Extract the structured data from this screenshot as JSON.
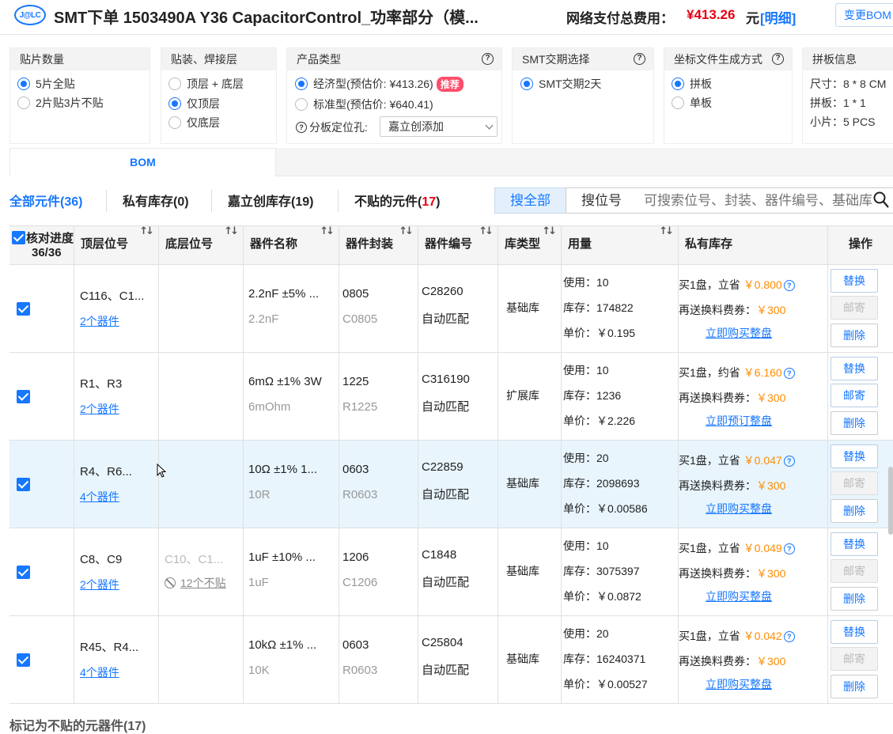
{
  "header": {
    "logo_text": "J@LC",
    "title": "SMT下单  1503490A  Y36  CapacitorControl_功率部分（模...",
    "fee_label": "网络支付总费用：",
    "fee_value": "¥413.26",
    "fee_unit": "元",
    "fee_detail": "[明细]",
    "change_bom": "变更BOM"
  },
  "options": {
    "qty": {
      "title": "贴片数量",
      "items": [
        "5片全贴",
        "2片贴3片不贴"
      ],
      "selected": 0
    },
    "layer": {
      "title": "贴装、焊接层",
      "items": [
        "顶层 + 底层",
        "仅顶层",
        "仅底层"
      ],
      "selected": 1
    },
    "product": {
      "title": "产品类型",
      "items": [
        "经济型(预估价: ¥413.26)",
        "标准型(预估价: ¥640.41)"
      ],
      "selected": 0,
      "badge": "推荐",
      "hole_label": "分板定位孔:",
      "hole_value": "嘉立创添加"
    },
    "delivery": {
      "title": "SMT交期选择",
      "items": [
        "SMT交期2天"
      ],
      "selected": 0
    },
    "coord": {
      "title": "坐标文件生成方式",
      "items": [
        "拼板",
        "单板"
      ],
      "selected": 0
    },
    "panel": {
      "title": "拼板信息",
      "size": "尺寸：8 * 8 CM",
      "panelize": "拼板：1 * 1",
      "pieces": "小片：5 PCS"
    }
  },
  "tabs": {
    "bom": "BOM"
  },
  "filters": [
    {
      "label": "全部元件(",
      "count": "36",
      "end": ")"
    },
    {
      "label": "私有库存(",
      "count": "0",
      "end": ")"
    },
    {
      "label": "嘉立创库存(",
      "count": "19",
      "end": ")"
    },
    {
      "label": "不贴的元件(",
      "count": "17",
      "end": ")"
    }
  ],
  "search": {
    "all": "搜全部",
    "pos": "搜位号",
    "placeholder": "可搜索位号、封装、器件编号、基础库"
  },
  "table": {
    "headers": [
      "核对进度",
      "36/36",
      "顶层位号",
      "底层位号",
      "器件名称",
      "器件封装",
      "器件编号",
      "库类型",
      "用量",
      "私有库存",
      "操作"
    ],
    "rows": [
      {
        "top": "C116、C1...",
        "top_count": "2个器件",
        "bottom": "",
        "bottom_note": "",
        "name": "2.2nF ±5% ...",
        "name_sub": "2.2nF",
        "pkg": "0805",
        "pkg_sub": "C0805",
        "code": "C28260",
        "match": "自动匹配",
        "lib": "基础库",
        "use": "使用：10",
        "stock": "库存：174822",
        "price": "单价：￥0.195",
        "buy": "买1盘，立省",
        "save": "￥0.800",
        "coupon": "再送换料费券：",
        "coupon_val": "￥300",
        "action_link": "立即购买整盘",
        "btn1": "替换",
        "btn2": "邮寄",
        "btn3": "删除",
        "mail_enabled": false
      },
      {
        "top": "R1、R3",
        "top_count": "2个器件",
        "bottom": "",
        "bottom_note": "",
        "name": "6mΩ ±1% 3W",
        "name_sub": "6mOhm",
        "pkg": "1225",
        "pkg_sub": "R1225",
        "code": "C316190",
        "match": "自动匹配",
        "lib": "扩展库",
        "use": "使用：10",
        "stock": "库存：1236",
        "price": "单价：￥2.226",
        "buy": "买1盘，约省",
        "save": "￥6.160",
        "coupon": "再送换料费券：",
        "coupon_val": "￥300",
        "action_link": "立即预订整盘",
        "btn1": "替换",
        "btn2": "邮寄",
        "btn3": "删除",
        "mail_enabled": true
      },
      {
        "top": "R4、R6...",
        "top_count": "4个器件",
        "bottom": "",
        "bottom_note": "",
        "name": "10Ω ±1% 1...",
        "name_sub": "10R",
        "pkg": "0603",
        "pkg_sub": "R0603",
        "code": "C22859",
        "match": "自动匹配",
        "lib": "基础库",
        "use": "使用：20",
        "stock": "库存：2098693",
        "price": "单价：￥0.00586",
        "buy": "买1盘，立省",
        "save": "￥0.047",
        "coupon": "再送换料费券：",
        "coupon_val": "￥300",
        "action_link": "立即购买整盘",
        "btn1": "替换",
        "btn2": "邮寄",
        "btn3": "删除",
        "mail_enabled": false
      },
      {
        "top": "C8、C9",
        "top_count": "2个器件",
        "bottom": "C10、C1...",
        "bottom_note": "12个不贴",
        "name": "1uF ±10% ...",
        "name_sub": "1uF",
        "pkg": "1206",
        "pkg_sub": "C1206",
        "code": "C1848",
        "match": "自动匹配",
        "lib": "基础库",
        "use": "使用：10",
        "stock": "库存：3075397",
        "price": "单价：￥0.0872",
        "buy": "买1盘，立省",
        "save": "￥0.049",
        "coupon": "再送换料费券：",
        "coupon_val": "￥300",
        "action_link": "立即购买整盘",
        "btn1": "替换",
        "btn2": "邮寄",
        "btn3": "删除",
        "mail_enabled": false
      },
      {
        "top": "R45、R4...",
        "top_count": "4个器件",
        "bottom": "",
        "bottom_note": "",
        "name": "10kΩ ±1% ...",
        "name_sub": "10K",
        "pkg": "0603",
        "pkg_sub": "R0603",
        "code": "C25804",
        "match": "自动匹配",
        "lib": "基础库",
        "use": "使用：20",
        "stock": "库存：16240371",
        "price": "单价：￥0.00527",
        "buy": "买1盘，立省",
        "save": "￥0.042",
        "coupon": "再送换料费券：",
        "coupon_val": "￥300",
        "action_link": "立即购买整盘",
        "btn1": "替换",
        "btn2": "邮寄",
        "btn3": "删除",
        "mail_enabled": false
      }
    ]
  },
  "footer": {
    "not_placed_title": "标记为不贴的元器件(17)"
  },
  "colors": {
    "accent": "#1677ff",
    "price_red": "#e60012",
    "save_orange": "#ff8c00",
    "highlight_row": "#e8f5fd"
  }
}
